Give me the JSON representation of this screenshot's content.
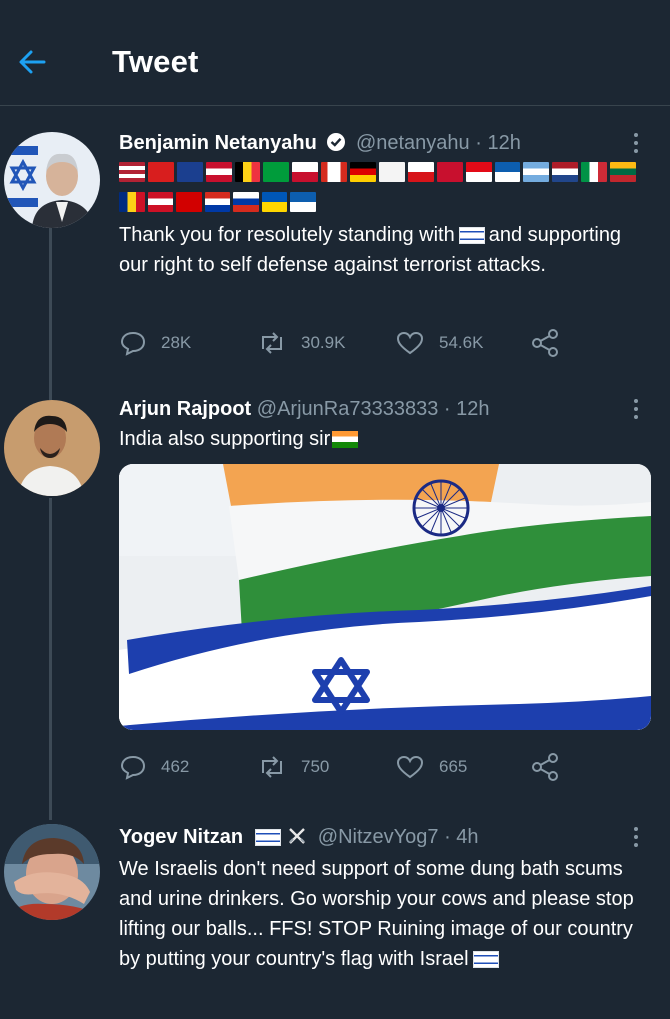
{
  "header": {
    "title": "Tweet"
  },
  "tweets": [
    {
      "name": "Benjamin Netanyahu",
      "verified": true,
      "handle": "@netanyahu",
      "time": "· 12h",
      "text": "Thank you for resolutely standing with",
      "text_rest": "and supporting our right to self defense against terrorist attacks.",
      "replies": "28K",
      "retweets": "30.9K",
      "likes": "54.6K"
    },
    {
      "name": "Arjun Rajpoot",
      "handle": "@ArjunRa73333833",
      "time": "· 12h",
      "text": "India also supporting sir",
      "replies": "462",
      "retweets": "750",
      "likes": "665"
    },
    {
      "name": "Yogev Nitzan",
      "handle": "@NitzevYog7",
      "time": "· 4h",
      "text": "We Israelis don't need support of some dung bath scums and urine drinkers. Go worship your cows and please stop lifting our balls... FFS! STOP Ruining image of our country by putting your country's flag with Israel"
    }
  ],
  "icons": {
    "back": "arrow-left-icon",
    "reply": "comment-icon",
    "retweet": "retweet-icon",
    "like": "heart-icon",
    "share": "share-icon",
    "more": "more-vertical-icon",
    "verified": "verified-badge-icon"
  },
  "colors": {
    "background": "#1c2733",
    "accent": "#1da1f2",
    "muted": "#8899a6",
    "divider": "#38444d"
  }
}
